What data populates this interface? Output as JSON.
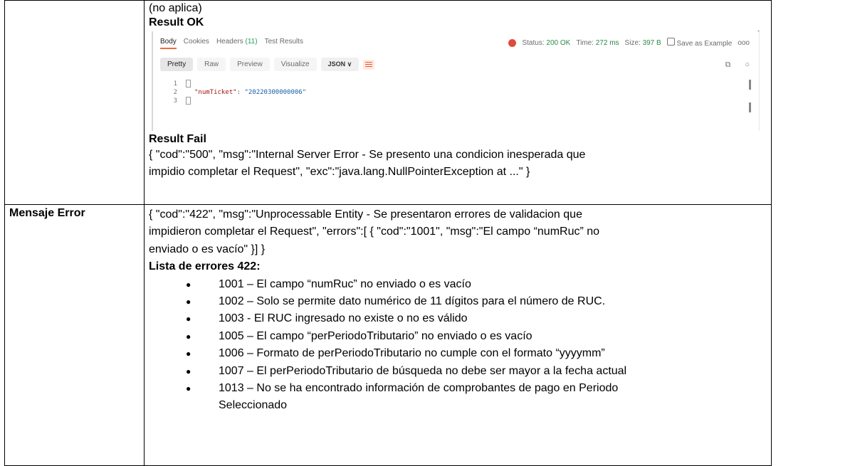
{
  "top_left": "",
  "no_aplica": "(no aplica)",
  "result_ok_label": "Result OK",
  "postman": {
    "tabs": [
      {
        "label": "Body",
        "count": ""
      },
      {
        "label": "Cookies",
        "count": ""
      },
      {
        "label": "Headers",
        "count": "(11)"
      },
      {
        "label": "Test Results",
        "count": ""
      }
    ],
    "status_label": "Status:",
    "status_value": "200 OK",
    "time_label": "Time:",
    "time_value": "272 ms",
    "size_label": "Size:",
    "size_value": "397 B",
    "save_label": "Save as Example",
    "more": "ooo",
    "view_buttons": [
      "Pretty",
      "Raw",
      "Preview",
      "Visualize"
    ],
    "format": "JSON",
    "format_chevron": "∨",
    "code_lines": [
      {
        "num": "1",
        "text": ""
      },
      {
        "num": "2",
        "key": "\"numTicket\"",
        "sep": ": ",
        "value": "\"20220300000006\""
      },
      {
        "num": "3",
        "text": ""
      }
    ]
  },
  "result_fail_label": "Result Fail",
  "result_fail_lines": [
    "{ \"cod\":\"500\", \"msg\":\"Internal Server Error - Se presento una condicion inesperada que",
    "impidio completar el Request\", \"exc\":\"java.lang.NullPointerException at ...\" }"
  ],
  "mensaje_error_label": "Mensaje Error",
  "mensaje_error_lines": [
    "{ \"cod\":\"422\", \"msg\":\"Unprocessable Entity - Se presentaron errores de validacion que",
    "impidieron completar el Request\", \"errors\":[ { \"cod\":\"1001\", \"msg\":\"El campo “numRuc” no",
    "enviado o es vacío\" }] }"
  ],
  "lista_label": "Lista de errores 422:",
  "errors": [
    "1001 – El campo “numRuc” no enviado o es vacío",
    "1002 – Solo se permite dato numérico de 11 dígitos para el número de RUC.",
    "1003 - El RUC ingresado no existe o no es válido",
    "1005 – El campo “perPeriodoTributario” no enviado o es vacío",
    "1006 – Formato de perPeriodoTributario no cumple con el formato “yyyymm”",
    "1007 – El perPeriodoTributario de búsqueda no debe ser mayor a la fecha actual",
    "1013 – No se ha encontrado información de comprobantes de pago en Periodo",
    "Seleccionado"
  ]
}
